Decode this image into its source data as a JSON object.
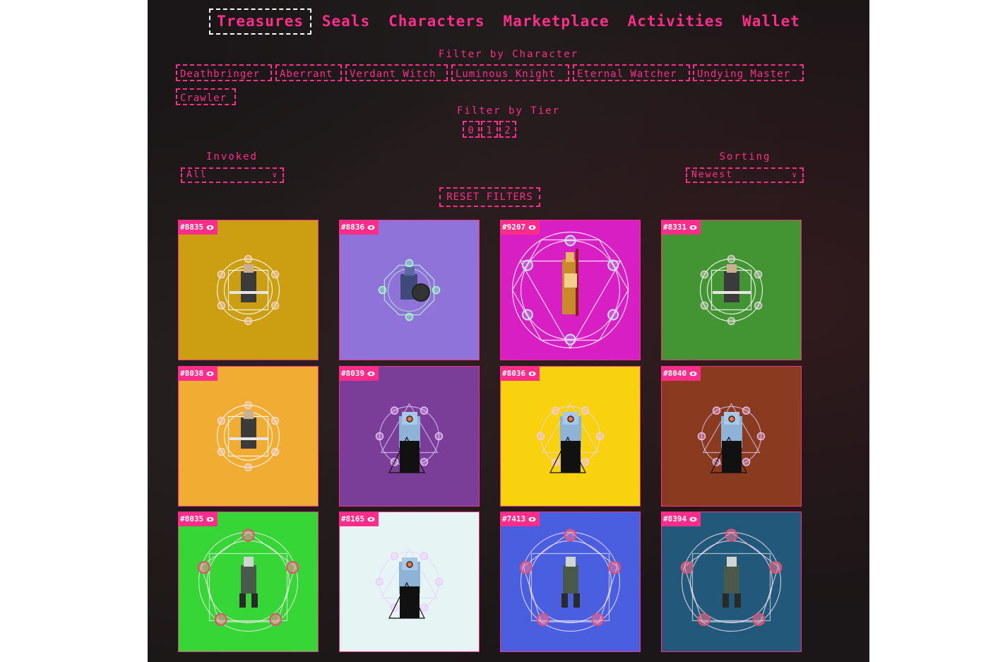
{
  "nav": {
    "items": [
      {
        "label": "Treasures",
        "active": true
      },
      {
        "label": "Seals",
        "active": false
      },
      {
        "label": "Characters",
        "active": false
      },
      {
        "label": "Marketplace",
        "active": false
      },
      {
        "label": "Activities",
        "active": false
      },
      {
        "label": "Wallet",
        "active": false
      }
    ]
  },
  "filters": {
    "character_title": "Filter by Character",
    "characters": [
      "Deathbringer",
      "Aberrant",
      "Verdant Witch",
      "Luminous Knight",
      "Eternal Watcher",
      "Undying Master",
      "Crawler"
    ],
    "tier_title": "Filter by Tier",
    "tiers": [
      "0",
      "1",
      "2"
    ],
    "invoked_label": "Invoked",
    "invoked_value": "All",
    "sorting_label": "Sorting",
    "sorting_value": "Newest",
    "reset_label": "RESET FILTERS"
  },
  "colors": {
    "accent": "#ff2d8a",
    "background": "#1b1617"
  },
  "cards": [
    {
      "id": "#8835",
      "bg": "#cc9e12",
      "art": "knight"
    },
    {
      "id": "#8836",
      "bg": "#8f73d9",
      "art": "aberrant"
    },
    {
      "id": "#9207",
      "bg": "#d81fc4",
      "art": "witch"
    },
    {
      "id": "#8331",
      "bg": "#439433",
      "art": "knight"
    },
    {
      "id": "#8038",
      "bg": "#f0ac33",
      "art": "knight"
    },
    {
      "id": "#8039",
      "bg": "#7a3e99",
      "art": "watcher"
    },
    {
      "id": "#8036",
      "bg": "#f8d10f",
      "art": "watcher"
    },
    {
      "id": "#8040",
      "bg": "#8a3a1e",
      "art": "watcher"
    },
    {
      "id": "#8035",
      "bg": "#36d637",
      "art": "master"
    },
    {
      "id": "#8165",
      "bg": "#e6f4f4",
      "art": "watcher"
    },
    {
      "id": "#7413",
      "bg": "#4a5fe0",
      "art": "master"
    },
    {
      "id": "#8394",
      "bg": "#22597a",
      "art": "master"
    }
  ]
}
